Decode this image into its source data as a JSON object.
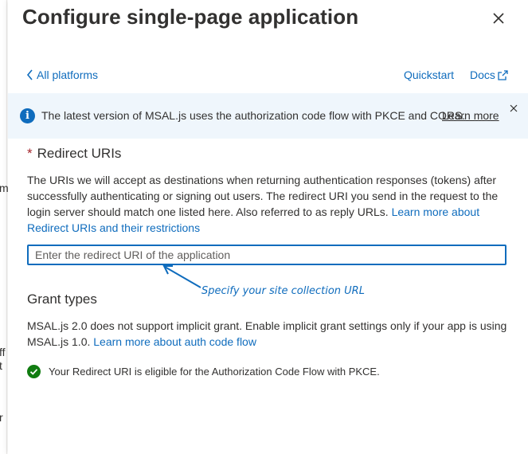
{
  "background_fragments": [
    "m",
    "ff",
    "t",
    "r"
  ],
  "panel": {
    "title": "Configure single-page application",
    "close_icon": "close-icon"
  },
  "nav": {
    "back_label": "All platforms",
    "quickstart_label": "Quickstart",
    "docs_label": "Docs"
  },
  "banner": {
    "message": "The latest version of MSAL.js uses the authorization code flow with PKCE and CORS.",
    "learn_more": "Learn more",
    "bg_color": "#eff6fc",
    "icon": "info-icon"
  },
  "redirect": {
    "required_marker": "*",
    "label": "Redirect URIs",
    "description": "The URIs we will accept as destinations when returning authentication responses (tokens) after successfully authenticating or signing out users. The redirect URI you send in the request to the login server should match one listed here. Also referred to as reply URLs.",
    "learn_link": "Learn more about Redirect URIs and their restrictions",
    "input_value": "",
    "input_placeholder": "Enter the redirect URI of the application"
  },
  "annotation": {
    "text": "Specify your site collection URL"
  },
  "grant": {
    "title": "Grant types",
    "description": "MSAL.js 2.0 does not support implicit grant. Enable implicit grant settings only if your app is using MSAL.js 1.0.",
    "learn_link": "Learn more about auth code flow",
    "eligible_text": "Your Redirect URI is eligible for the Authorization Code Flow with PKCE."
  },
  "colors": {
    "accent": "#0f6cbd",
    "required": "#a4262c",
    "success": "#107c10"
  }
}
